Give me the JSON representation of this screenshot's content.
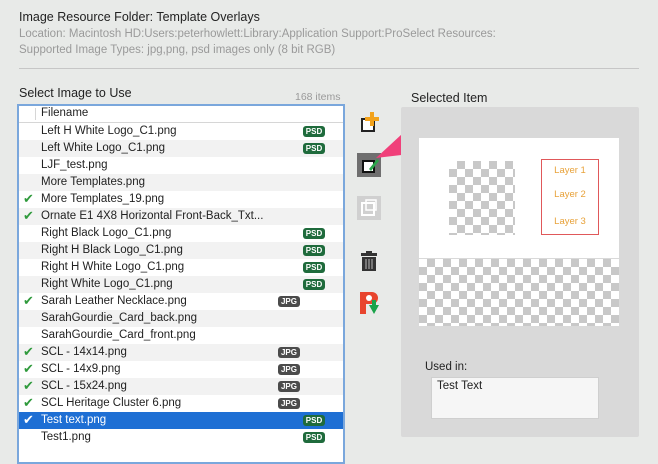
{
  "header": {
    "title": "Image Resource Folder: Template Overlays",
    "location": "Location: Macintosh HD:Users:peterhowlett:Library:Application Support:ProSelect Resources:",
    "types": "Supported Image Types: jpg,png, psd images only (8 bit RGB)"
  },
  "list": {
    "label": "Select Image to Use",
    "count": "168 items",
    "column_header": "Filename",
    "rows": [
      {
        "name": "Left H White Logo_C1.png",
        "checked": false,
        "badge": "PSD"
      },
      {
        "name": "Left White Logo_C1.png",
        "checked": false,
        "badge": "PSD"
      },
      {
        "name": "LJF_test.png",
        "checked": false,
        "badge": ""
      },
      {
        "name": "More Templates.png",
        "checked": false,
        "badge": ""
      },
      {
        "name": "More Templates_19.png",
        "checked": true,
        "badge": ""
      },
      {
        "name": "Ornate E1 4X8 Horizontal Front-Back_Txt...",
        "checked": true,
        "badge": ""
      },
      {
        "name": "Right Black Logo_C1.png",
        "checked": false,
        "badge": "PSD"
      },
      {
        "name": "Right H Black Logo_C1.png",
        "checked": false,
        "badge": "PSD"
      },
      {
        "name": "Right H White Logo_C1.png",
        "checked": false,
        "badge": "PSD"
      },
      {
        "name": "Right White Logo_C1.png",
        "checked": false,
        "badge": "PSD"
      },
      {
        "name": "Sarah Leather Necklace.png",
        "checked": true,
        "badge": "JPG"
      },
      {
        "name": "SarahGourdie_Card_back.png",
        "checked": false,
        "badge": ""
      },
      {
        "name": "SarahGourdie_Card_front.png",
        "checked": false,
        "badge": ""
      },
      {
        "name": "SCL - 14x14.png",
        "checked": true,
        "badge": "JPG"
      },
      {
        "name": "SCL - 14x9.png",
        "checked": true,
        "badge": "JPG"
      },
      {
        "name": "SCL - 15x24.png",
        "checked": true,
        "badge": "JPG"
      },
      {
        "name": "SCL Heritage Cluster 6.png",
        "checked": true,
        "badge": "JPG"
      },
      {
        "name": "Test text.png",
        "checked": true,
        "badge": "PSD",
        "selected": true
      },
      {
        "name": "Test1.png",
        "checked": false,
        "badge": "PSD"
      }
    ]
  },
  "selected_item": {
    "label": "Selected Item",
    "layers": [
      "Layer 1",
      "Layer 2",
      "Layer 3"
    ],
    "used_in_label": "Used in:",
    "used_in_value": "Test Text"
  },
  "toolbar": {
    "icons": [
      "add-image-icon",
      "edit-image-icon",
      "duplicate-image-icon",
      "trash-icon",
      "export-icon"
    ],
    "accent": "#e8452e"
  },
  "colors": {
    "selection": "#1e6fd4",
    "psd_badge": "#1f6b3c",
    "jpg_badge": "#4b4b4b",
    "check": "#2f9a3c",
    "arrow": "#f0407a"
  }
}
